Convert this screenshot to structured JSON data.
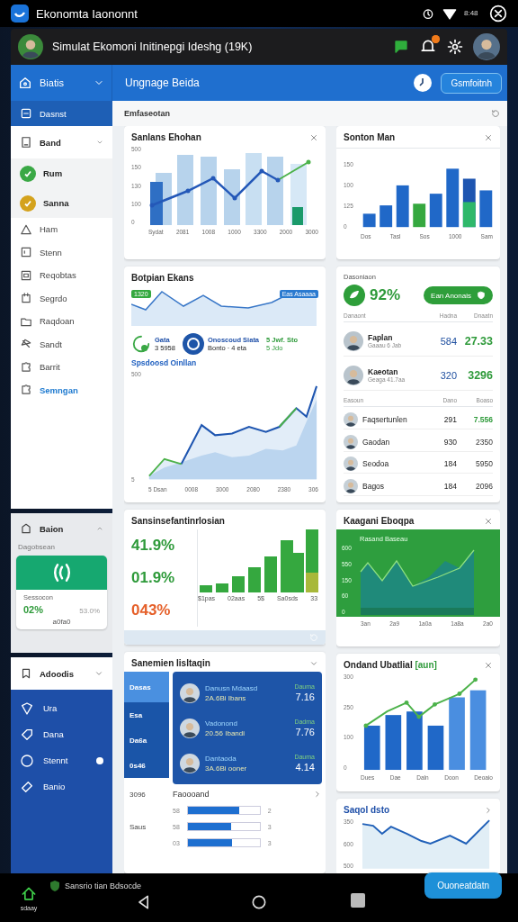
{
  "status_bar": {
    "app_name": "Ekonomta Iaononnt",
    "time": "8:48"
  },
  "header": {
    "title": "Simulat Ekomoni Initinepgi Ideshg (19K)"
  },
  "toolbar": {
    "section": "Biatis",
    "page_title": "Ungnage Beida",
    "button": "Gsmfoitnh"
  },
  "sidebar": {
    "top_item": {
      "label": "Dasnst",
      "selected": true
    },
    "group": {
      "label": "Band",
      "expanded": true,
      "items": [
        {
          "label": "Rum",
          "kind": "dot",
          "color": "#3aa845",
          "selected": false
        },
        {
          "label": "Sanna",
          "kind": "dot",
          "color": "#d4a21c",
          "selected": false
        },
        {
          "label": "Ham",
          "kind": "icon",
          "selected": false
        },
        {
          "label": "Stenn",
          "kind": "icon",
          "selected": false
        },
        {
          "label": "Reqobtas",
          "kind": "icon",
          "selected": false
        },
        {
          "label": "Segrdo",
          "kind": "icon",
          "selected": false
        },
        {
          "label": "Raqdoan",
          "kind": "icon",
          "selected": false
        },
        {
          "label": "Sandt",
          "kind": "icon",
          "selected": false
        },
        {
          "label": "Barrit",
          "kind": "icon",
          "selected": false
        },
        {
          "label": "Semngan",
          "kind": "icon",
          "selected": true
        }
      ]
    },
    "balance": {
      "label": "Baion",
      "expanded": false,
      "subtitle": "Dagobsean",
      "card_label": "Sessocon",
      "value": "02%",
      "secondary": "53.0%",
      "footer": "a0fa0"
    },
    "accounts": {
      "label": "Adoodis",
      "expanded": true,
      "items": [
        {
          "label": "Ura",
          "selected": false
        },
        {
          "label": "Dana",
          "selected": false
        },
        {
          "label": "Stennt",
          "selected": true
        },
        {
          "label": "Banio",
          "selected": false
        }
      ]
    }
  },
  "main": {
    "heading": "Emfaseotan",
    "left": [
      {
        "kind": "combo",
        "title": "Sanlans Ehohan",
        "y_labels": [
          "500",
          "150",
          "130",
          "100",
          "0"
        ],
        "x_labels": [
          "Sydat",
          "2081",
          "1008",
          "1000",
          "3300",
          "2000",
          "3000"
        ]
      },
      {
        "kind": "overview",
        "title": "Botpian Ekans",
        "tags": [
          "1320",
          "Eas Asaaaa"
        ],
        "stats": [
          {
            "kind": "ring",
            "title": "Gata",
            "value": "3 5958"
          },
          {
            "kind": "coin",
            "title": "Onoscoud Siata",
            "value": "Bonto · 4 eta"
          },
          {
            "kind": "plain",
            "title": "5 Jwf. Sto",
            "value": "5 Jdo"
          }
        ],
        "chart_title": "Spsdoosd Oinllan",
        "y_labels": [
          "500",
          "5"
        ],
        "x_labels": [
          "5 Dsan",
          "0008",
          "3000",
          "2080",
          "2380",
          "306"
        ]
      },
      {
        "kind": "kpi",
        "title": "Sansinsefantinrlosian",
        "figures": [
          {
            "text": "41.9%",
            "color": "#2e9a3a"
          },
          {
            "text": "01.9%",
            "color": "#2e9a3a"
          },
          {
            "text": "043%",
            "color": "#e5602a"
          }
        ],
        "labels": [
          "$1pas",
          "02aas",
          "5$",
          "Sa0sds",
          "33"
        ]
      },
      {
        "kind": "tabs",
        "title": "Sanemien Iisltaqin",
        "tabs": [
          {
            "label": "Dasas",
            "selected": true
          },
          {
            "label": "Esa",
            "selected": false
          },
          {
            "label": "Da6a",
            "selected": false
          },
          {
            "label": "0s46",
            "selected": false
          }
        ],
        "extra_labels": [
          "3096",
          "Saus"
        ],
        "people": [
          {
            "name": "Danusn Mdaasd",
            "sub": "2A.6Bi Ibans",
            "label": "Dauma",
            "value": "7.16"
          },
          {
            "name": "Vadonond",
            "sub": "20.56 Ibandi",
            "label": "Dadma",
            "value": "7.76"
          },
          {
            "name": "Dantaoda",
            "sub": "3A.6Bi ooner",
            "label": "Dauma",
            "value": "4.14"
          }
        ],
        "progress_title": "Faoooand",
        "progress": [
          {
            "label": "58",
            "level": 0.72,
            "value": "2"
          },
          {
            "label": "58",
            "level": 0.6,
            "value": "3"
          },
          {
            "label": "03",
            "level": 0.62,
            "value": "3"
          }
        ]
      }
    ],
    "right": [
      {
        "kind": "bars",
        "title": "Sonton Man",
        "y_labels": [
          "150",
          "100",
          "125",
          "0"
        ],
        "x_labels": [
          "Dos",
          "Tasl",
          "Sos",
          "1000",
          "Sam"
        ]
      },
      {
        "kind": "table",
        "title": "Dasoniaon",
        "score": "92%",
        "button": "Ean Anonais",
        "columns": [
          "Danaont",
          "Hadna",
          "Dnaatn"
        ],
        "rows": [
          {
            "name": "Faplan",
            "sub": "Gaaau 6 Jab",
            "count": "584",
            "value": "27.33"
          },
          {
            "name": "Kaeotan",
            "sub": "Geaga 41.7aa",
            "count": "320",
            "value": "3296"
          }
        ],
        "columns_2": [
          "Easoun",
          "Dano",
          "Boaso"
        ],
        "rows_2": [
          {
            "name": "Faqsertunlen",
            "count": "291",
            "value": "7.556",
            "positive": true
          },
          {
            "name": "Gaodan",
            "count": "930",
            "value": "2350",
            "positive": false
          },
          {
            "name": "Seodoa",
            "count": "184",
            "value": "5950",
            "positive": false
          },
          {
            "name": "Bagos",
            "count": "184",
            "value": "2096",
            "positive": false
          }
        ]
      },
      {
        "kind": "green-area",
        "title": "Kaagani Eboqpa",
        "chart_title": "Rasand Baseau",
        "y_labels": [
          "600",
          "550",
          "150",
          "60",
          "0"
        ],
        "x_labels": [
          "3an",
          "2a9",
          "1a0a",
          "1a8a",
          "2a0"
        ]
      },
      {
        "kind": "bar-line",
        "title": "Ondand Ubatlial",
        "tag": "[aun]",
        "y_labels": [
          "300",
          "250",
          "100",
          "0"
        ],
        "x_labels": [
          "Dues",
          "Dae",
          "Daln",
          "Doon",
          "Deoaio"
        ]
      },
      {
        "kind": "line",
        "title": "Saqol dsto",
        "y_labels": [
          "350",
          "600",
          "500"
        ]
      }
    ]
  },
  "nav_bar": {
    "home_label": "sdaay",
    "status": "Sansrio tian Bdsocde",
    "fab": "Ouoneatdatn"
  }
}
